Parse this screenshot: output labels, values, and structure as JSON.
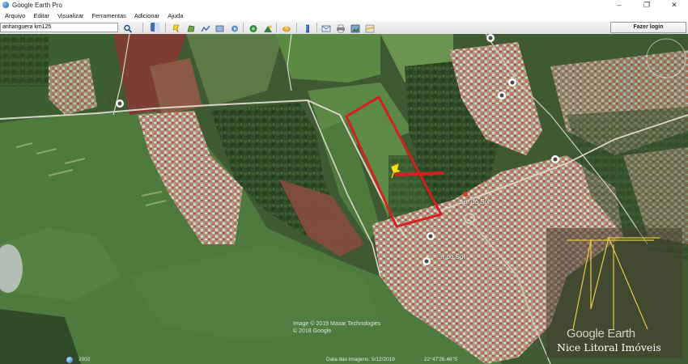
{
  "window": {
    "title": "Google Earth Pro",
    "controls": [
      "–",
      "❐",
      "✕"
    ]
  },
  "menu": [
    "Arquivo",
    "Editar",
    "Visualizar",
    "Ferramentas",
    "Adicionar",
    "Ajuda"
  ],
  "search": {
    "value": "anhanguera km125"
  },
  "toolbar": {
    "login_label": "Fazer login",
    "icons": [
      "search-icon",
      "sidebar-icon",
      "placemark-icon",
      "polygon-icon",
      "path-icon",
      "overlay-icon",
      "tour-icon",
      "historical-imagery-icon",
      "sunlight-icon",
      "planet-icon",
      "ruler-icon",
      "email-icon",
      "print-icon",
      "save-image-icon",
      "maps-icon"
    ]
  },
  "map": {
    "copyright": "Image © 2019 Maxar Technologies\n© 2018 Google",
    "imagery_date_label": "Data das imagens: 5/12/2019",
    "coordinates": "22°47'26.46\"S",
    "scale_label": "2002",
    "place_labels": [
      "...ur do Sol",
      "...r do Sol"
    ],
    "parcel_outline_color": "#d6201f",
    "marker_color": "#ffe21a"
  },
  "watermark": {
    "brand": "Google Earth",
    "company": "Nice Litoral Imóveis",
    "logo_color": "#e8c64a"
  }
}
